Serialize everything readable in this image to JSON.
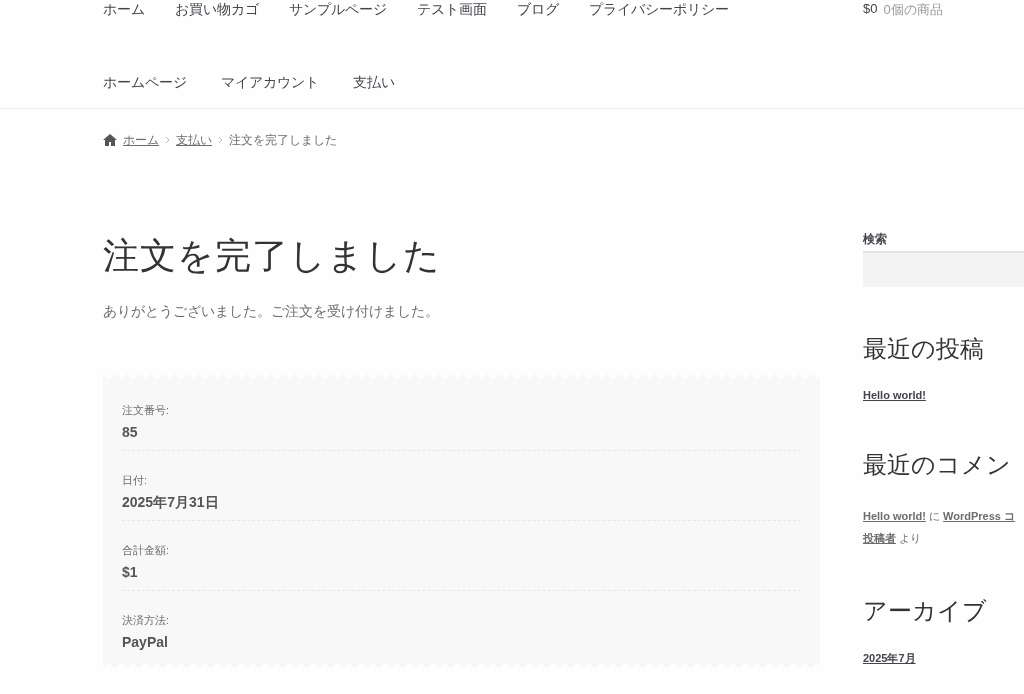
{
  "top_nav": {
    "items": [
      {
        "label": "ホーム"
      },
      {
        "label": "お買い物カゴ"
      },
      {
        "label": "サンプルページ"
      },
      {
        "label": "テスト画面"
      },
      {
        "label": "ブログ"
      },
      {
        "label": "プライバシーポリシー"
      }
    ],
    "cart": {
      "amount": "$0",
      "count": "0個の商品"
    }
  },
  "secondary_nav": [
    {
      "label": "ホームページ"
    },
    {
      "label": "マイアカウント"
    },
    {
      "label": "支払い"
    }
  ],
  "breadcrumb": {
    "links": [
      "ホーム",
      "支払い"
    ],
    "current": "注文を完了しました"
  },
  "title": "注文を完了しました",
  "message": "ありがとうございました。ご注文を受け付けました。",
  "order_details": [
    {
      "label": "注文番号:",
      "value": "85"
    },
    {
      "label": "日付:",
      "value": "2025年7月31日"
    },
    {
      "label": "合計金額:",
      "value": "$1"
    },
    {
      "label": "決済方法:",
      "value": "PayPal"
    }
  ],
  "sidebar": {
    "search_label": "検索",
    "recent_posts": {
      "heading": "最近の投稿",
      "items": [
        "Hello world!"
      ]
    },
    "recent_comments": {
      "heading": "最近のコメン",
      "post": "Hello world!",
      "on": "に",
      "author": "WordPress コ",
      "author_line2": "投稿者",
      "by": "より"
    },
    "archives": {
      "heading": "アーカイブ",
      "items": [
        "2025年7月"
      ]
    }
  }
}
